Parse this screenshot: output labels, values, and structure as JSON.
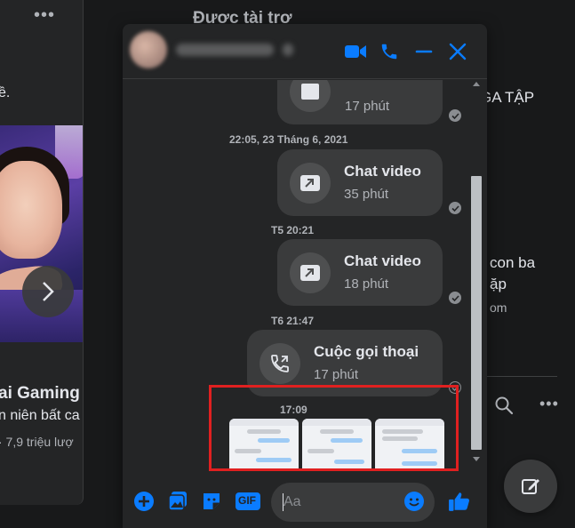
{
  "feed": {
    "more_label": "•••",
    "frag_e": "ề.",
    "page_name": "ai Gaming",
    "page_desc": "n niên bất ca",
    "views": "· 7,9 triệu lượ"
  },
  "right": {
    "sponsored": "Được tài trợ",
    "line1": "GA TẬP",
    "line2": "con ba",
    "line3": "ặp",
    "line4": "om",
    "more_label": "•••"
  },
  "chat": {
    "messages": [
      {
        "kind": "video",
        "title": "",
        "subtitle": "17 phút"
      },
      {
        "kind": "timestamp",
        "text": "22:05, 23 Tháng 6, 2021"
      },
      {
        "kind": "video",
        "title": "Chat video",
        "subtitle": "35 phút"
      },
      {
        "kind": "timestamp",
        "text": "T5 20:21"
      },
      {
        "kind": "video",
        "title": "Chat video",
        "subtitle": "18 phút"
      },
      {
        "kind": "timestamp",
        "text": "T6 21:47"
      },
      {
        "kind": "audio",
        "title": "Cuộc gọi thoại",
        "subtitle": "17 phút"
      },
      {
        "kind": "timestamp",
        "text": "17:09"
      }
    ],
    "composer_placeholder": "Aa",
    "gif_label": "GIF"
  },
  "colors": {
    "accent": "#0a7cff",
    "highlight": "#e02020",
    "panel": "#242526",
    "bubble": "#3a3b3c"
  },
  "icons": {
    "header": [
      "video-call-icon",
      "phone-icon",
      "minimize-icon",
      "close-icon"
    ],
    "composer": [
      "plus-icon",
      "photo-icon",
      "sticker-icon",
      "gif-icon",
      "emoji-icon",
      "like-icon"
    ]
  }
}
